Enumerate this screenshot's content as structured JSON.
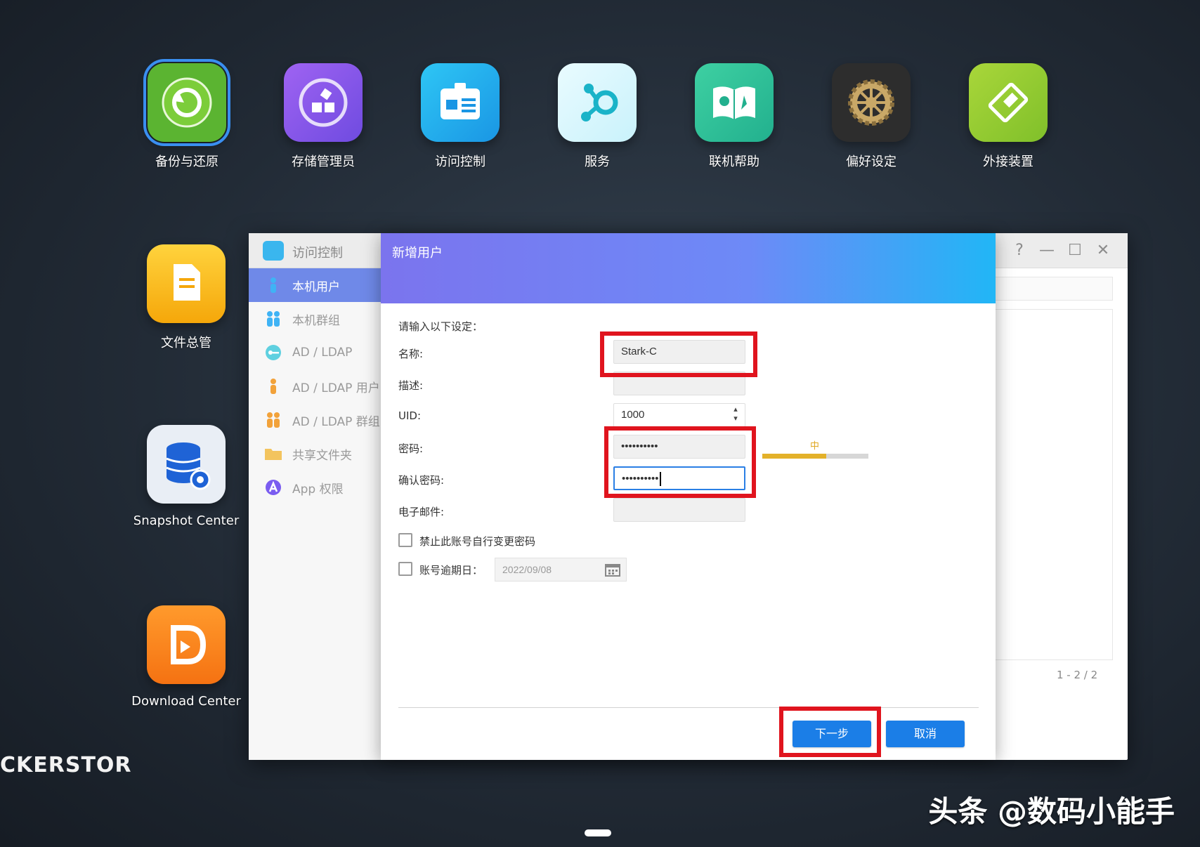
{
  "desktop": {
    "icons": [
      {
        "label": "备份与还原",
        "icon": "backup-restore-icon"
      },
      {
        "label": "存储管理员",
        "icon": "storage-manager-icon"
      },
      {
        "label": "访问控制",
        "icon": "access-control-icon"
      },
      {
        "label": "服务",
        "icon": "services-icon"
      },
      {
        "label": "联机帮助",
        "icon": "online-help-icon"
      },
      {
        "label": "偏好设定",
        "icon": "preferences-icon"
      },
      {
        "label": "外接装置",
        "icon": "external-device-icon"
      },
      {
        "label": "文件总管",
        "icon": "file-manager-icon"
      },
      {
        "label": "Snapshot Center",
        "icon": "snapshot-center-icon"
      },
      {
        "label": "Download Center",
        "icon": "download-center-icon"
      }
    ],
    "brand_logo": "CKERSTOR",
    "credit": "头条 @数码小能手"
  },
  "app_window": {
    "title": "访问控制",
    "sidebar": [
      {
        "label": "本机用户",
        "active": true,
        "icon": "user-icon"
      },
      {
        "label": "本机群组",
        "active": false,
        "icon": "group-icon"
      },
      {
        "label": "AD / LDAP",
        "active": false,
        "icon": "key-icon"
      },
      {
        "label": "AD / LDAP 用户",
        "active": false,
        "icon": "user-icon"
      },
      {
        "label": "AD / LDAP 群组",
        "active": false,
        "icon": "group-icon"
      },
      {
        "label": "共享文件夹",
        "active": false,
        "icon": "folder-icon"
      },
      {
        "label": "App 权限",
        "active": false,
        "icon": "app-icon"
      }
    ],
    "pager": "1 - 2 / 2",
    "controls": {
      "help": "?",
      "minimize": "—",
      "maximize": "☐",
      "close": "✕"
    }
  },
  "dialog": {
    "title": "新增用户",
    "prompt": "请输入以下设定：",
    "fields": {
      "name": {
        "label": "名称:",
        "value": "Stark-C"
      },
      "description": {
        "label": "描述:",
        "value": ""
      },
      "uid": {
        "label": "UID:",
        "value": "1000"
      },
      "password": {
        "label": "密码:",
        "value": "••••••••••"
      },
      "confirm_password": {
        "label": "确认密码:",
        "value": "••••••••••"
      },
      "email": {
        "label": "电子邮件:",
        "value": ""
      }
    },
    "password_strength": {
      "label": "中",
      "level": 0.6
    },
    "checkboxes": {
      "disallow_change": {
        "label": "禁止此账号自行变更密码",
        "checked": false
      },
      "expiry": {
        "label": "账号逾期日：",
        "checked": false,
        "date": "2022/09/08"
      }
    },
    "buttons": {
      "next": "下一步",
      "cancel": "取消"
    }
  },
  "colors": {
    "accent": "#1b7ee7",
    "annotation": "#e0141e",
    "header_start": "#7b74ee",
    "header_end": "#21b6f6",
    "strength": "#e3b12a"
  }
}
